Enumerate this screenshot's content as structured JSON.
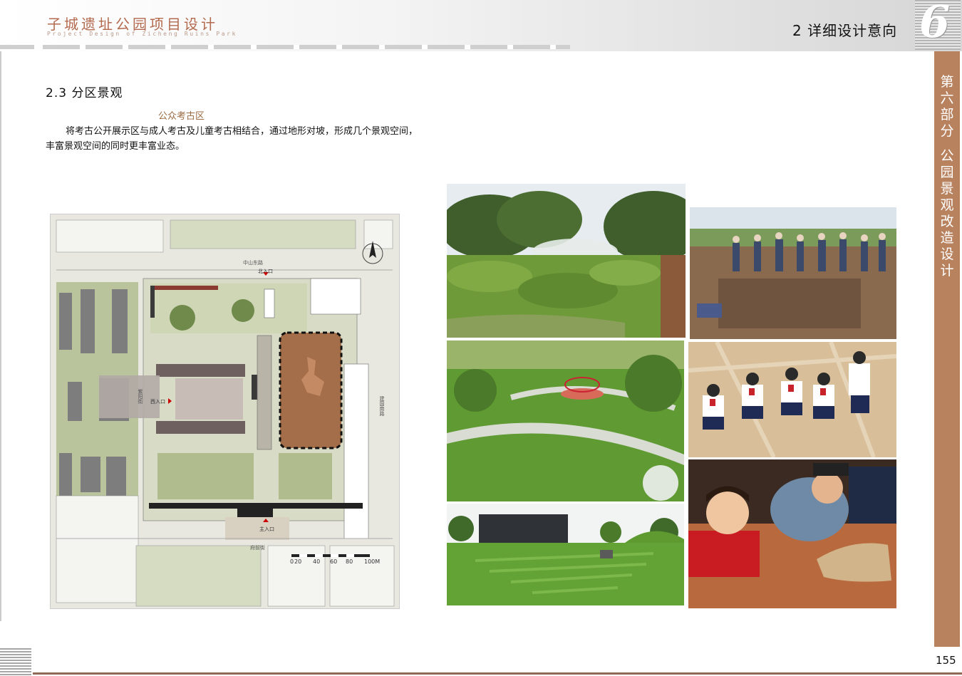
{
  "header": {
    "title": "子城遗址公园项目设计",
    "subtitle": "Project Design of Zicheng Ruins Park",
    "section": "2  详细设计意向",
    "part_number": "6"
  },
  "sidebar": {
    "part": "第六部分",
    "name": "公园景观改造设计"
  },
  "content": {
    "section_title": "2.3  分区景观",
    "zone_title": "公众考古区",
    "paragraph_line1": "将考古公开展示区与成人考古及儿童考古相结合，通过地形对坡，形成几个景观空间，",
    "paragraph_line2": "丰富景观空间的同时更丰富业态。"
  },
  "plan": {
    "road_north": "中山东路",
    "road_south": "府前街",
    "road_east": "建国南路",
    "road_west": "紫阳街",
    "entrance_north": "北入口",
    "entrance_west": "西入口",
    "entrance_south": "主入口",
    "scale_labels": [
      "0",
      "20",
      "40",
      "60",
      "80",
      "100M"
    ]
  },
  "photos": [
    {
      "id": "mound-park",
      "desc": "grassy mounds with mist"
    },
    {
      "id": "adult-dig",
      "desc": "excavation site with visitors"
    },
    {
      "id": "terraced-lawn",
      "desc": "curving lawn paths and pavilion"
    },
    {
      "id": "children-sand",
      "desc": "children digging in sand"
    },
    {
      "id": "grass-amphitheater",
      "desc": "stepped green amphitheater"
    },
    {
      "id": "kids-dig-closeup",
      "desc": "kids uncovering bones"
    }
  ],
  "footer": {
    "page_number": "155"
  }
}
